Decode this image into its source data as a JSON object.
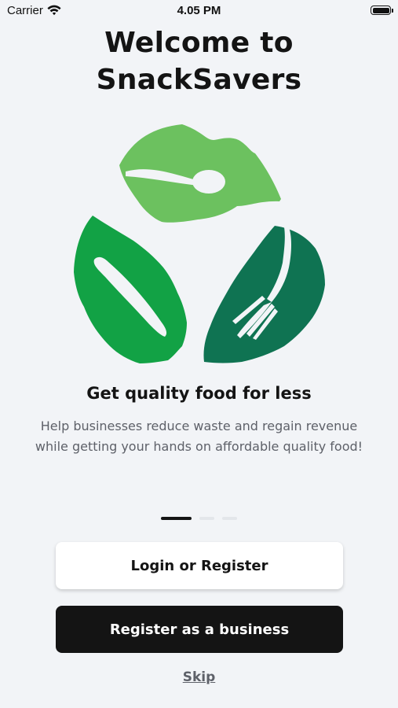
{
  "status_bar": {
    "carrier": "Carrier",
    "time": "4.05 PM",
    "battery_level": 1.0,
    "icons": [
      "wifi-icon",
      "battery-icon"
    ]
  },
  "welcome": {
    "title_line1": "Welcome to",
    "title_line2": "SnackSavers"
  },
  "logo": {
    "description_icon": "recycle-leaves-cutlery-logo",
    "colors": {
      "leaf_light": "#6cc15f",
      "leaf_medium": "#12a245",
      "leaf_dark": "#0f7352"
    }
  },
  "slide": {
    "headline": "Get quality food for less",
    "description": "Help businesses reduce waste and regain revenue while getting your hands on affordable quality food!"
  },
  "pager": {
    "count": 3,
    "active_index": 0
  },
  "actions": {
    "login_label": "Login or Register",
    "business_label": "Register as a business",
    "skip_label": "Skip"
  },
  "colors": {
    "background": "#f2f4f7",
    "primary_dark": "#141414",
    "secondary_text": "#5e6169"
  }
}
